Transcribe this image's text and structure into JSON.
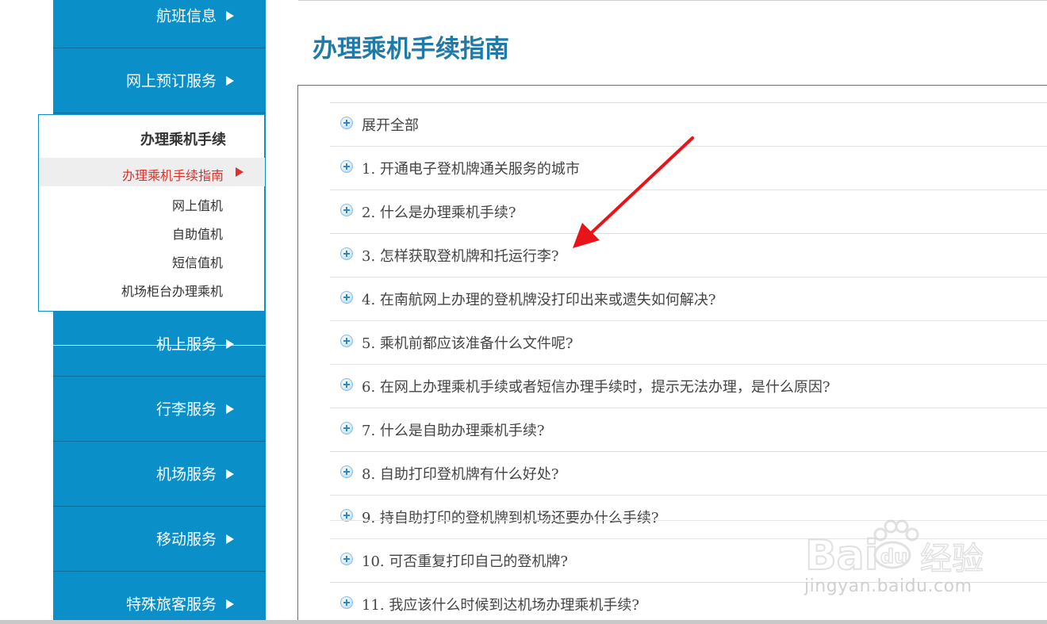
{
  "sidebar": {
    "items": [
      {
        "label": "航班信息"
      },
      {
        "label": "网上预订服务"
      },
      {
        "label": "机上服务"
      },
      {
        "label": "行李服务"
      },
      {
        "label": "机场服务"
      },
      {
        "label": "移动服务"
      },
      {
        "label": "特殊旅客服务"
      }
    ],
    "submenu": {
      "title": "办理乘机手续",
      "active": "办理乘机手续指南",
      "links": [
        "网上值机",
        "自助值机",
        "短信值机",
        "机场柜台办理乘机"
      ]
    }
  },
  "main": {
    "title": "办理乘机手续指南",
    "expand_all": "展开全部",
    "questions": [
      "1. 开通电子登机牌通关服务的城市",
      "2. 什么是办理乘机手续?",
      "3. 怎样获取登机牌和托运行李?",
      "4. 在南航网上办理的登机牌没打印出来或遗失如何解决?",
      "5. 乘机前都应该准备什么文件呢?",
      "6. 在网上办理乘机手续或者短信办理手续时，提示无法办理，是什么原因?",
      "7. 什么是自助办理乘机手续?",
      "8. 自助打印登机牌有什么好处?",
      "9. 持自助打印的登机牌到机场还要办什么手续?",
      "10. 可否重复打印自己的登机牌?",
      "11. 我应该什么时候到达机场办理乘机手续?"
    ]
  },
  "watermark": {
    "logo": "Baidu经验",
    "url": "jingyan.baidu.com"
  },
  "colors": {
    "sidebar_blue": "#0a8fc8",
    "title_blue": "#1f7aa8",
    "active_red": "#e0302a",
    "annotation_red": "#e8141a"
  },
  "icons": {
    "nav": "triangle-right-icon",
    "faq": "plus-circle-icon"
  }
}
